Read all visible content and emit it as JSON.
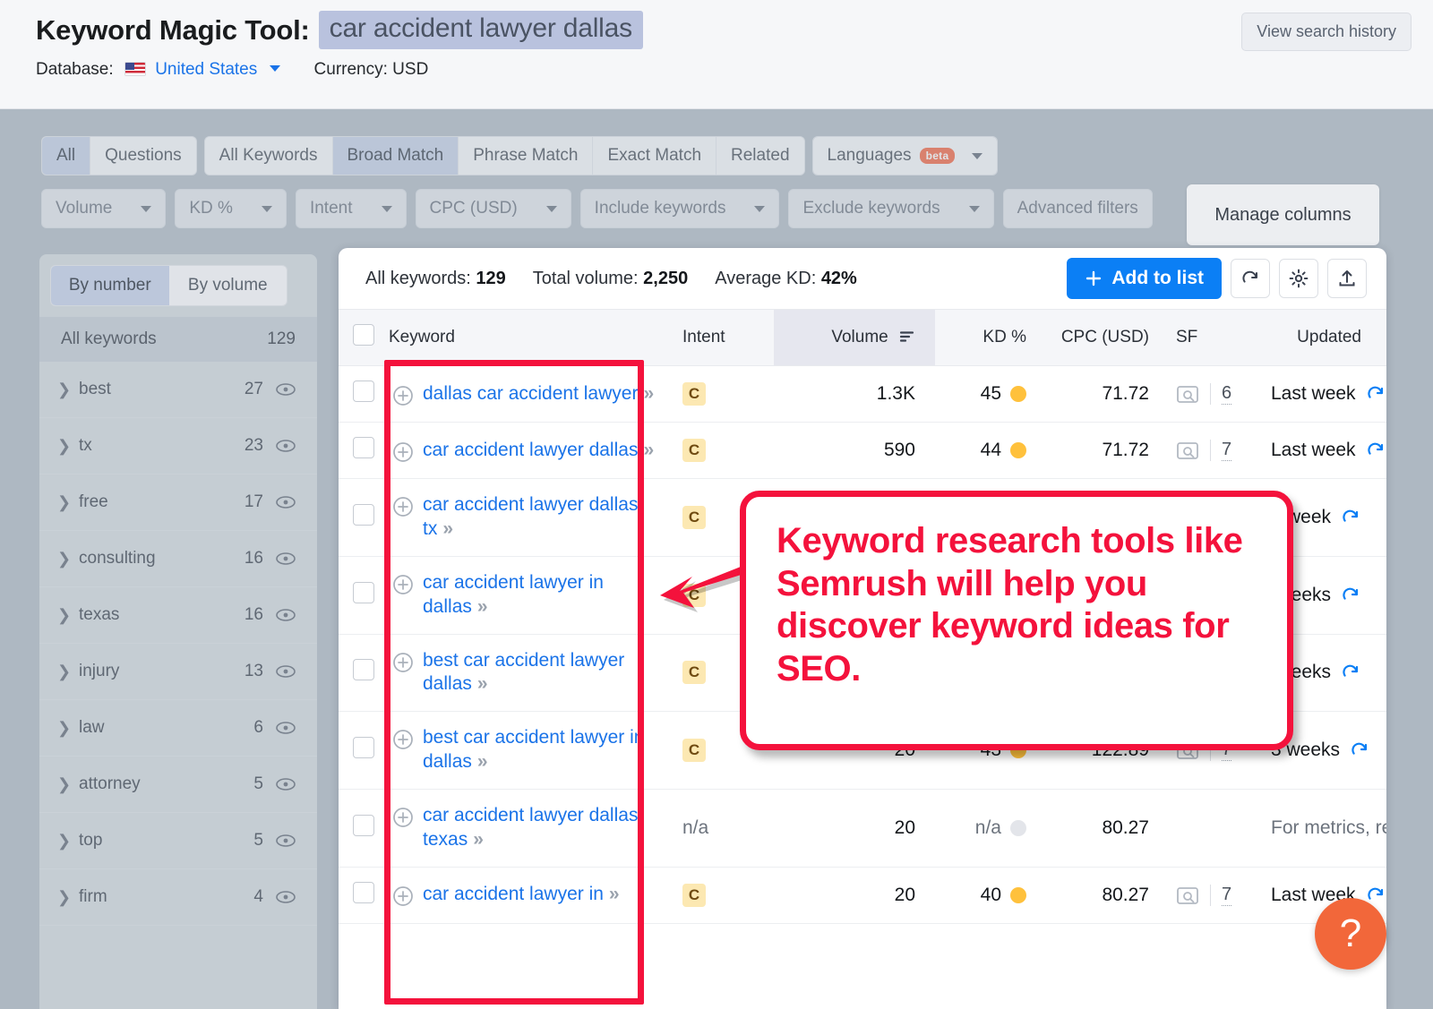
{
  "header": {
    "tool_title": "Keyword Magic Tool:",
    "query": "car accident lawyer dallas",
    "view_history_label": "View search history",
    "database_label": "Database:",
    "database_value": "United States",
    "currency_label": "Currency: USD"
  },
  "chips": {
    "group1": [
      "All",
      "Questions"
    ],
    "group2": [
      "All Keywords",
      "Broad Match",
      "Phrase Match",
      "Exact Match",
      "Related"
    ],
    "languages_label": "Languages",
    "languages_beta": "beta",
    "active_group1": "All",
    "active_group2": "Broad Match"
  },
  "filters": [
    "Volume",
    "KD %",
    "Intent",
    "CPC (USD)",
    "Include keywords",
    "Exclude keywords",
    "Advanced filters"
  ],
  "manage_columns_label": "Manage columns",
  "sidebar": {
    "toggle": [
      "By number",
      "By volume"
    ],
    "toggle_active": "By number",
    "all_keywords_label": "All keywords",
    "all_keywords_count": "129",
    "items": [
      {
        "label": "best",
        "count": "27"
      },
      {
        "label": "tx",
        "count": "23"
      },
      {
        "label": "free",
        "count": "17"
      },
      {
        "label": "consulting",
        "count": "16"
      },
      {
        "label": "texas",
        "count": "16"
      },
      {
        "label": "injury",
        "count": "13"
      },
      {
        "label": "law",
        "count": "6"
      },
      {
        "label": "attorney",
        "count": "5"
      },
      {
        "label": "top",
        "count": "5"
      },
      {
        "label": "firm",
        "count": "4"
      }
    ]
  },
  "results": {
    "summary": {
      "all_keywords_label": "All keywords:",
      "all_keywords_value": "129",
      "total_volume_label": "Total volume:",
      "total_volume_value": "2,250",
      "average_kd_label": "Average KD:",
      "average_kd_value": "42%"
    },
    "add_to_list_label": "Add to list",
    "columns": [
      "Keyword",
      "Intent",
      "Volume",
      "KD %",
      "CPC (USD)",
      "SF",
      "Updated"
    ],
    "sorted_column": "Volume",
    "rows": [
      {
        "keyword": "dallas car accident lawyer",
        "intent": "C",
        "volume": "1.3K",
        "kd": "45",
        "cpc": "71.72",
        "sf": "6",
        "updated": "Last week"
      },
      {
        "keyword": "car accident lawyer dallas",
        "intent": "C",
        "volume": "590",
        "kd": "44",
        "cpc": "71.72",
        "sf": "7",
        "updated": "Last week"
      },
      {
        "keyword": "car accident lawyer dallas tx",
        "intent": "C",
        "volume": "",
        "kd": "",
        "cpc": "",
        "sf": "",
        "updated": "week"
      },
      {
        "keyword": "car accident lawyer in dallas",
        "intent": "C",
        "volume": "",
        "kd": "",
        "cpc": "",
        "sf": "",
        "updated": "eeks"
      },
      {
        "keyword": "best car accident lawyer dallas",
        "intent": "C",
        "volume": "",
        "kd": "",
        "cpc": "",
        "sf": "",
        "updated": "eeks"
      },
      {
        "keyword": "best car accident lawyer in dallas",
        "intent": "C",
        "volume": "20",
        "kd": "43",
        "cpc": "122.89",
        "sf": "7",
        "updated": "3 weeks"
      },
      {
        "keyword": "car accident lawyer dallas texas",
        "intent": "n/a",
        "volume": "20",
        "kd": "n/a",
        "cpc": "80.27",
        "sf": "",
        "updated": "For metrics, refresh"
      },
      {
        "keyword": "car accident lawyer in",
        "intent": "C",
        "volume": "20",
        "kd": "40",
        "cpc": "80.27",
        "sf": "7",
        "updated": "Last week"
      }
    ]
  },
  "annotation": {
    "callout_text": "Keyword research tools like Semrush will help you discover keyword ideas for SEO."
  },
  "help_label": "?",
  "colors": {
    "accent_blue": "#0b7ff5",
    "link_blue": "#1a73e8",
    "annotation_red": "#f4123c",
    "intent_badge": "#fce8b2",
    "kd_dot": "#ffc13c",
    "help_fab": "#f2673a",
    "query_chip": "#b9c2de"
  }
}
